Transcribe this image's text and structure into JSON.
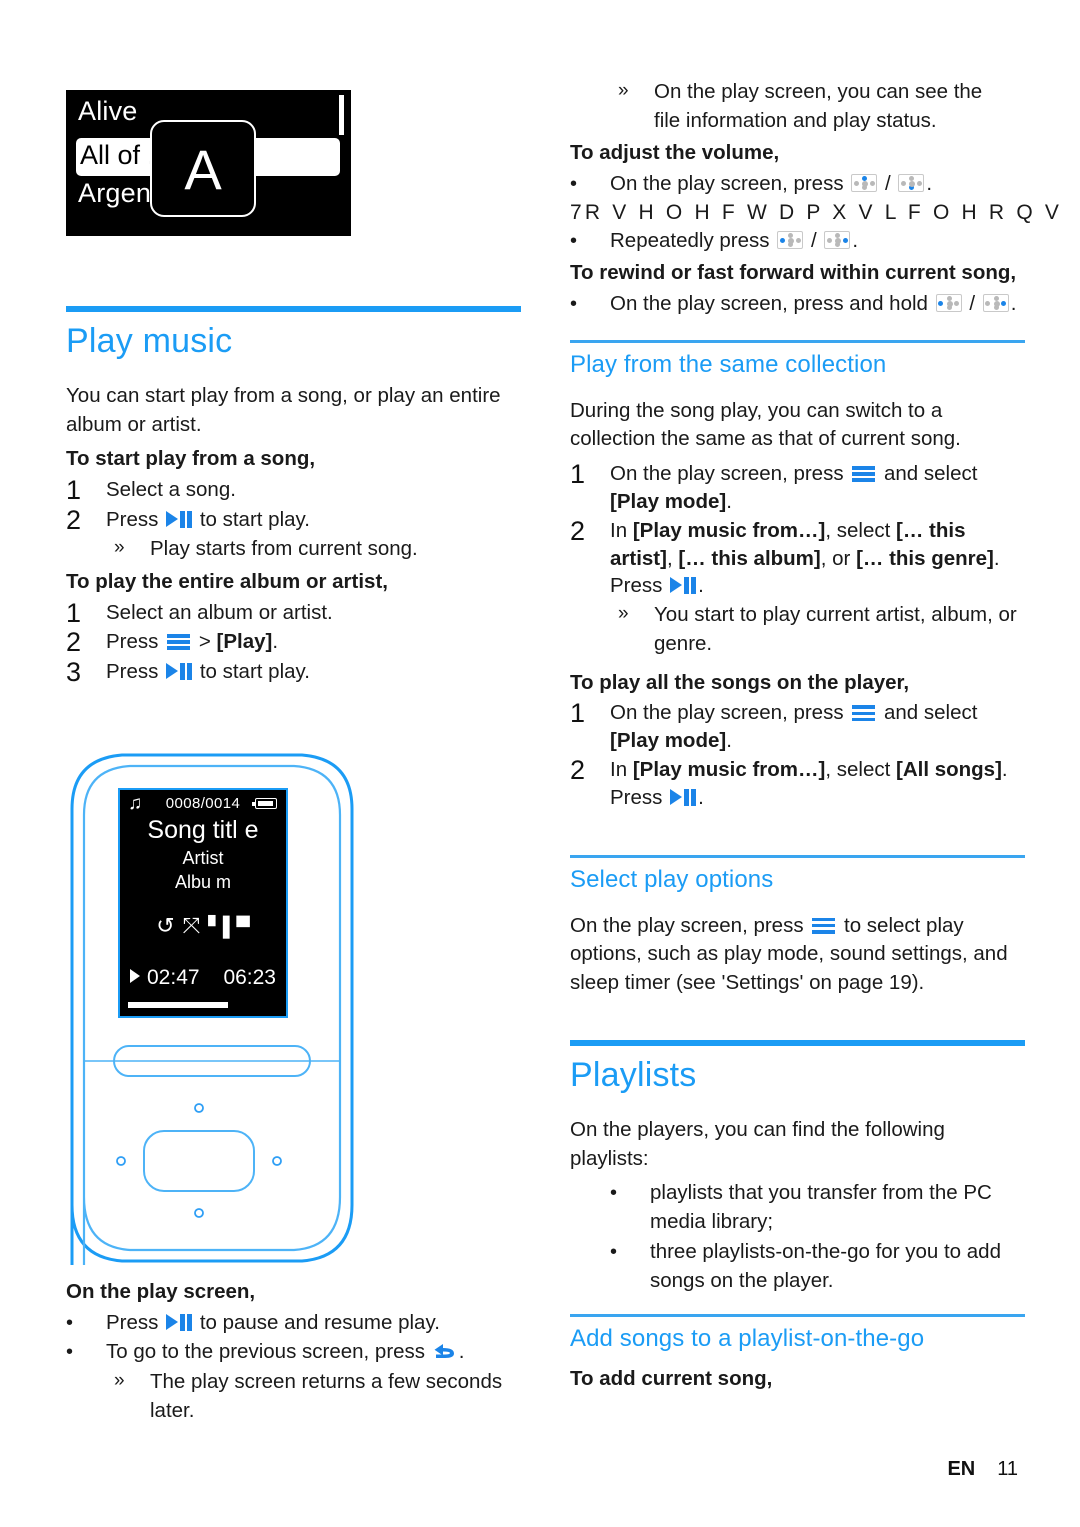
{
  "footer": {
    "language": "EN",
    "page_number": "11"
  },
  "lcd_browse": {
    "item1": "Alive",
    "item2_highlighted": "All of ...e",
    "item3": "Argentina",
    "overlay_letter": "A"
  },
  "device_screen": {
    "track_counter": "0008/0014",
    "song_title": "Song titl e",
    "artist": "Artist",
    "album": "Albu m",
    "elapsed_time": "02:47",
    "total_time": "06:23"
  },
  "left_column": {
    "heading": "Play music",
    "intro": "You can start play from a song, or play an entire album or artist.",
    "sub1_title": "To start play from a song,",
    "sub1_step1_num": "1",
    "sub1_step1": "Select a song.",
    "sub1_step2_num": "2",
    "sub1_step2_pre": "Press",
    "sub1_step2_post": "to start play.",
    "sub1_note_mark": "»",
    "sub1_note": "Play starts from current song.",
    "sub2_title": "To play the entire album or artist,",
    "sub2_step1_num": "1",
    "sub2_step1": "Select an album or artist.",
    "sub2_step2_num": "2",
    "sub2_step2_pre": "Press",
    "sub2_step2_mid": ">",
    "sub2_step2_bracket": "[Play]",
    "sub2_step2_post": ".",
    "sub2_step3_num": "3",
    "sub2_step3_pre": "Press",
    "sub2_step3_post": "to start play.",
    "onplay_title": "On the play screen,",
    "bullet_mark": "•",
    "onplay_b1_pre": "Press",
    "onplay_b1_post": "to pause and resume play.",
    "onplay_b2_pre": "To go to the previous screen, press",
    "onplay_b2_post": ".",
    "onplay_note_mark": "»",
    "onplay_note": "The play screen returns a few seconds later."
  },
  "right_column": {
    "top_note_mark": "»",
    "top_note": "On the play screen, you can see the file information and play status.",
    "vol_title": "To adjust the volume,",
    "bullet_mark": "•",
    "vol_b1_pre": "On the play screen, press",
    "vol_slash": "/",
    "vol_b1_post": ".",
    "garbled_line": "7R  V H O H F W   D   P X V L F    O H   R Q   V",
    "vol_b2_pre": "Repeatedly press",
    "vol_b2_post": ".",
    "rew_title": "To rewind or fast forward within current song,",
    "rew_b1_pre": "On the play screen, press and hold",
    "rew_b1_post": ".",
    "collection_heading": "Play from the same collection",
    "collection_intro": "During the song play, you can switch to a collection the same as that of current song.",
    "coll_s1_num": "1",
    "coll_s1_pre": "On the play screen, press",
    "coll_s1_mid": "and select",
    "coll_s1_bracket": "[Play mode]",
    "coll_s1_post": ".",
    "coll_s2_num": "2",
    "coll_s2_p1": "In",
    "coll_s2_b1": "[Play music from…]",
    "coll_s2_p2": ", select",
    "coll_s2_b2": "[… this artist]",
    "coll_s2_p3": ",",
    "coll_s2_b3": "[… this album]",
    "coll_s2_p4": ", or",
    "coll_s2_b4": "[… this genre]",
    "coll_s2_p5": ". Press",
    "coll_s2_p6": ".",
    "coll_note_mark": "»",
    "coll_note": "You start to play current artist, album, or genre.",
    "allsongs_title": "To play all the songs on the player,",
    "all_s1_num": "1",
    "all_s1_pre": "On the play screen, press",
    "all_s1_mid": "and select",
    "all_s1_bracket": "[Play mode]",
    "all_s1_post": ".",
    "all_s2_num": "2",
    "all_s2_p1": "In",
    "all_s2_b1": "[Play music from…]",
    "all_s2_p2": ", select",
    "all_s2_b2": "[All songs]",
    "all_s2_p3": ". Press",
    "all_s2_p4": ".",
    "options_heading": "Select play options",
    "options_p1": "On the play screen, press",
    "options_p2": "to select play options, such as play mode, sound settings, and sleep timer (see 'Settings' on page 19).",
    "playlists_heading": "Playlists",
    "playlists_intro": "On the players, you can find the following playlists:",
    "playlists_b1": "playlists that you transfer from the PC media library;",
    "playlists_b2": "three playlists-on-the-go for you to add songs on the player.",
    "addsongs_heading": "Add songs to a playlist-on-the-go",
    "addsongs_sub": "To add current song,"
  },
  "colors": {
    "accent_blue": "#1b9cf5",
    "icon_blue": "#1b84e8",
    "text_black": "#1a1a1a"
  }
}
